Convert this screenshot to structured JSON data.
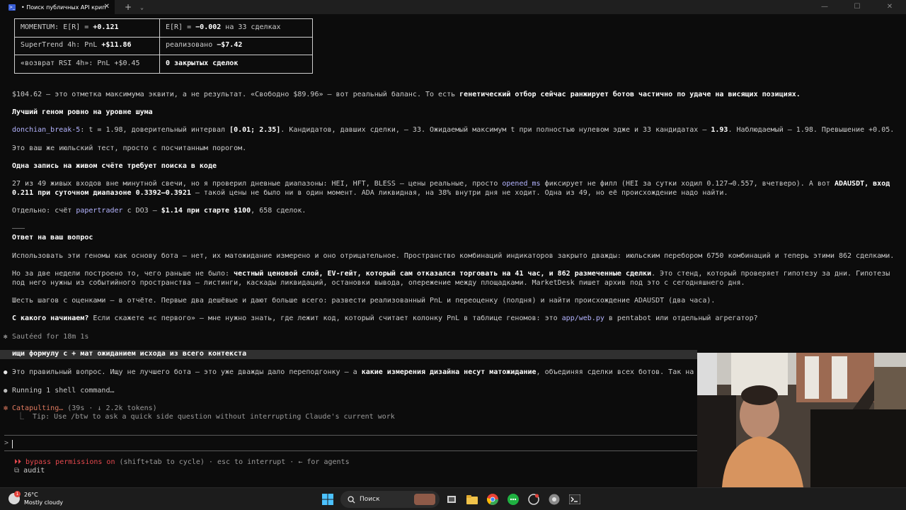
{
  "window": {
    "tab_title": "• Поиск публичных API крип",
    "ps_glyph": ">_",
    "close_glyph": "✕",
    "new_tab_glyph": "+",
    "dropdown_glyph": "⌄",
    "minimize_glyph": "—",
    "maximize_glyph": "☐",
    "window_close_glyph": "✕"
  },
  "table": {
    "rows": [
      {
        "left_prefix": "MOMENTUM: E[R] = ",
        "left_value": "+0.121",
        "right_prefix": "E[R] = ",
        "right_value": "−0.002",
        "right_suffix": " на 33 сделках"
      },
      {
        "left_prefix": "SuperTrend 4h: PnL ",
        "left_value": "+$11.86",
        "right_prefix": "реализовано ",
        "right_value": "−$7.42",
        "right_suffix": ""
      },
      {
        "left_prefix": "«возврат RSI 4h»: PnL +$0.45",
        "left_value": "",
        "right_prefix": "",
        "right_value": "0 закрытых сделок",
        "right_suffix": ""
      }
    ]
  },
  "content": {
    "p1_a": "$104.62 — это отметка максимума эквити, а не результат. «Свободно $89.96» — вот реальный баланс. То есть ",
    "p1_b": "генетический отбор сейчас ранжирует ботов частично по удаче на висящих позициях.",
    "h1": "Лучший геном ровно на уровне шума",
    "p2_code": "donchian_break-5",
    "p2_a": ": t = 1.98, доверительный интервал ",
    "p2_b": "[0.01; 2.35]",
    "p2_c": ". Кандидатов, давших сделки, — 33. Ожидаемый максимум t при полностью нулевом эдже и 33 кандидатах — ",
    "p2_d": "1.93",
    "p2_e": ". Наблюдаемый — 1.98. Превышение +0.05.",
    "p3": "Это ваш же июльский тест, просто с посчитанным порогом.",
    "h2": "Одна запись на живом счёте требует поиска в коде",
    "p4_a": "27 из 49 живых входов вне минутной свечи, но я проверил дневные диапазоны: HEI, HFT, BLESS — цены реальные, просто ",
    "p4_code": "opened_ms",
    "p4_b": " фиксирует не филл (HEI за сутки ходил 0.127→0.557, вчетверо). А вот ",
    "p4_c": "ADAUSDT, вход",
    "p4_d": "0.211 при суточном диапазоне 0.3392–0.3921",
    "p4_e": " — такой цены не было ни в один момент. ADA ликвидная, на 38% внутри дня не ходит. Одна из 49, но её происхождение надо найти.",
    "p5_a": "Отдельно: счёт ",
    "p5_code": "papertrader",
    "p5_b": " с DO3 — ",
    "p5_c": "$1.14 при старте $100",
    "p5_d": ", 658 сделок.",
    "sep": "———",
    "h3": "Ответ на ваш вопрос",
    "p6": "Использовать эти геномы как основу бота — нет, их матожидание измерено и оно отрицательное. Пространство комбинаций индикаторов закрыто дважды: июльским перебором 6750 комбинаций и теперь этими 862 сделками.",
    "p7_a": "Но за две недели построено то, чего раньше не было: ",
    "p7_b": "честный ценовой слой, EV-гейт, который сам отказался торговать на 41 час, и 862 размеченные сделки",
    "p7_c": ". Это стенд, который проверяет гипотезу за дни. Гипотезы",
    "p7_d": "под него нужны из событийного пространства — листинги, каскады ликвидаций, остановки вывода, опережение между площадками. MarketDesk пишет архив под это с сегодняшнего дня.",
    "p8": "Шесть шагов с оценками — в отчёте. Первые два дешёвые и дают больше всего: развести реализованный PnL и переоценку (полдня) и найти происхождение ADAUSDT (два часа).",
    "p9_a": "С какого начинаем?",
    "p9_b": " Если скажете «с первого» — мне нужно знать, где лежит код, который считает колонку PnL в таблице геномов: это ",
    "p9_code": "app/web.py",
    "p9_c": " в pentabot или отдельный агрегатор?"
  },
  "session": {
    "star": "✻",
    "sauteed": "Sautéed for 18m 1s",
    "user_prompt": "ищи формулу с + мат ожиданием исхода из всего контекста",
    "bullet": "●",
    "reply_a": "Это правильный вопрос. Ищу не лучшего бота — это уже дважды дало переподгонку — а ",
    "reply_b": "какие измерения дизайна несут матожидание",
    "reply_c": ", объединяя сделки всех ботов. Так на",
    "running": "Running 1 shell command…",
    "catapulting": "Catapulting…",
    "catapulting_meta": " (39s · ↓ 2.2k tokens)",
    "tip": "⎿  Tip: Use /btw to ask a quick side question without interrupting Claude's current work",
    "prompt_char": ">",
    "bypass_glyph": "⏵⏵",
    "bypass": "bypass permissions on",
    "bypass_rest": " (shift+tab to cycle) · esc to interrupt · ← for agents",
    "audit_glyph": "⧉",
    "audit": "audit"
  },
  "taskbar": {
    "temp": "26°C",
    "condition": "Mostly cloudy",
    "badge": "1",
    "search_placeholder": "Поиск"
  },
  "colors": {
    "code": "#b4b4ff",
    "accent_orange": "#e07a5f",
    "bypass_red": "#e5484d"
  }
}
